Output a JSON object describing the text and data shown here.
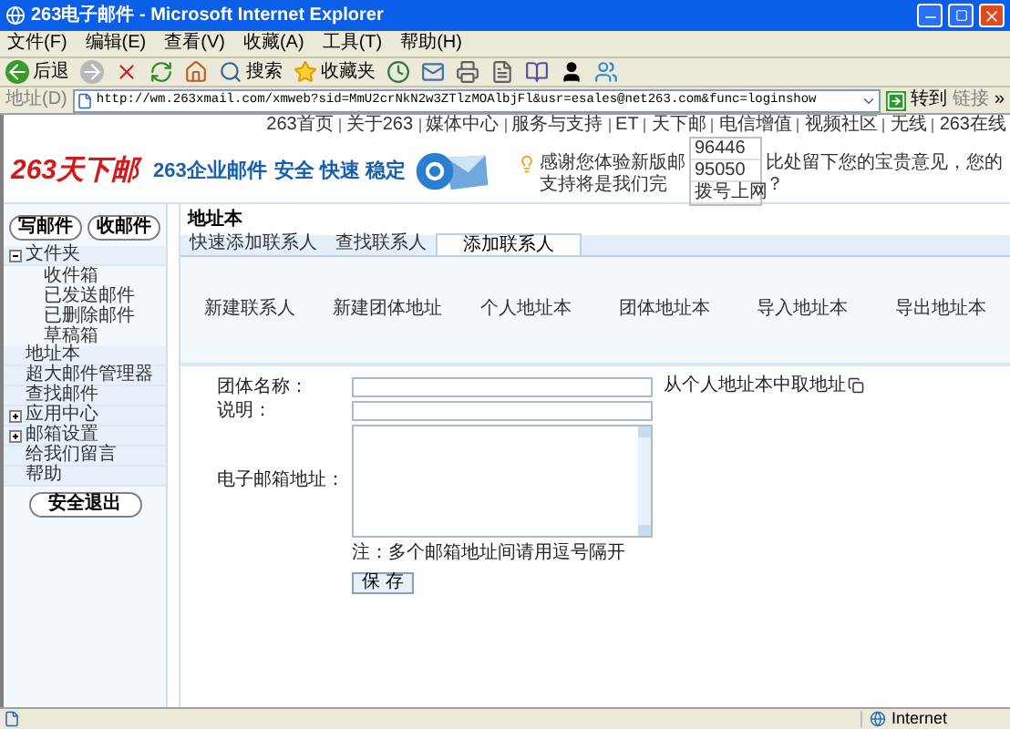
{
  "window": {
    "title": "263电子邮件 - Microsoft Internet Explorer"
  },
  "menu_bar": [
    "文件(F)",
    "编辑(E)",
    "查看(V)",
    "收藏(A)",
    "工具(T)",
    "帮助(H)"
  ],
  "toolbar": [
    {
      "kind": "back",
      "label": "后退"
    },
    {
      "kind": "forward"
    },
    {
      "kind": "stop"
    },
    {
      "kind": "refresh"
    },
    {
      "kind": "home"
    },
    {
      "kind": "search",
      "label": "搜索"
    },
    {
      "kind": "favorites",
      "label": "收藏夹"
    },
    {
      "kind": "history"
    },
    {
      "kind": "mail"
    },
    {
      "kind": "print"
    },
    {
      "kind": "edit"
    },
    {
      "kind": "research"
    },
    {
      "kind": "qq"
    },
    {
      "kind": "messenger"
    }
  ],
  "address_bar": {
    "label": "地址(D)",
    "url": "http://wm.263xmail.com/xmweb?sid=MmU2crNkN2w3ZTlzMOAlbjFl&usr=esales@net263.com&func=loginshow",
    "go": "转到",
    "links": "链接",
    "more": "»"
  },
  "header": {
    "top_links": [
      "263首页",
      "关于263",
      "媒体中心",
      "服务与支持",
      "ET",
      "天下邮",
      "电信增值",
      "视频社区",
      "无线",
      "263在线"
    ],
    "logo": "263天下邮",
    "slogan": "263企业邮件",
    "tagline": "安全 快速 稳定",
    "notice": [
      {
        "left": "感谢您体验新版邮",
        "right": "比处留下您的宝贵意见，您的"
      },
      {
        "left": "支持将是我们完",
        "right": "？"
      }
    ],
    "dropdown": [
      "96446",
      "95050",
      "拨号上网"
    ]
  },
  "sidebar": {
    "buttons": [
      "写邮件",
      "收邮件"
    ],
    "tree": [
      {
        "label": "文件夹",
        "expanded": true,
        "children": [
          {
            "label": "收件箱"
          },
          {
            "label": "已发送邮件"
          },
          {
            "label": "已删除邮件"
          },
          {
            "label": "草稿箱"
          }
        ]
      },
      {
        "label": "地址本"
      },
      {
        "label": "超大邮件管理器"
      },
      {
        "label": "查找邮件"
      },
      {
        "label": "应用中心",
        "expanded": false
      },
      {
        "label": "邮箱设置",
        "expanded": false
      },
      {
        "label": "给我们留言"
      },
      {
        "label": "帮助"
      }
    ],
    "logout": "安全退出"
  },
  "main": {
    "section_title": "地址本",
    "tabs": [
      {
        "label": "快速添加联系人",
        "selected": false
      },
      {
        "label": "查找联系人",
        "selected": false
      },
      {
        "label": "添加联系人",
        "selected": true
      }
    ],
    "actions": [
      "新建联系人",
      "新建团体地址",
      "个人地址本",
      "团体地址本",
      "导入地址本",
      "导出地址本"
    ],
    "form": [
      {
        "label": "团体名称：",
        "kind": "input"
      },
      {
        "label": "说明：",
        "kind": "input"
      },
      {
        "label": "电子邮箱地址：",
        "kind": "textarea"
      }
    ],
    "pick_link": "从个人地址本中取地址",
    "note": "注：多个邮箱地址间请用逗号隔开",
    "save": "保 存"
  },
  "status_bar": {
    "zone": "Internet"
  }
}
